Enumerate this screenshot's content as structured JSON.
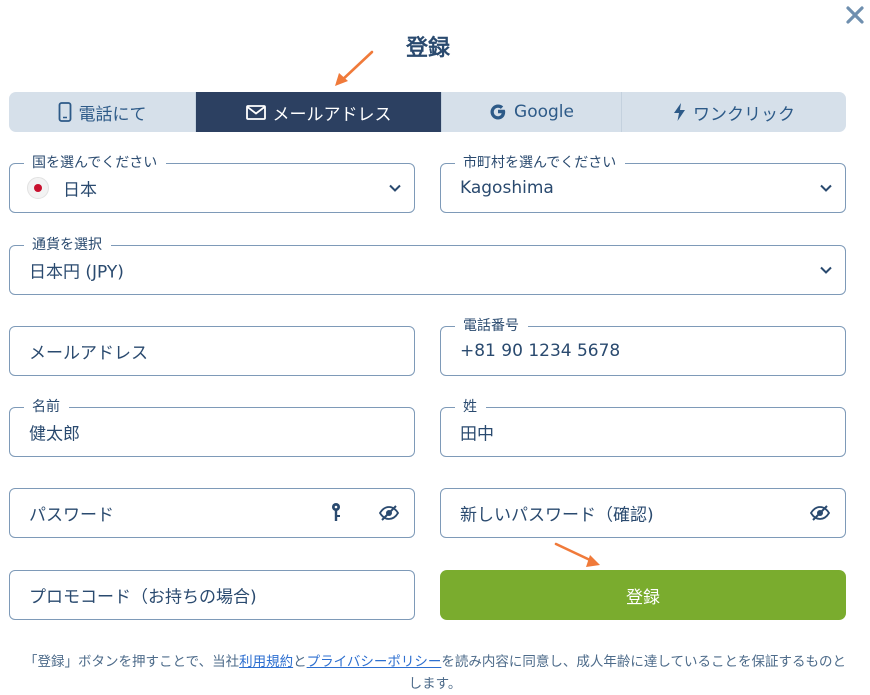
{
  "title": "登録",
  "close_icon": "close-icon",
  "tabs": [
    {
      "label": "電話にて",
      "icon": "phone-icon"
    },
    {
      "label": "メールアドレス",
      "icon": "envelope-icon",
      "active": true
    },
    {
      "label": "Google",
      "icon": "google-icon"
    },
    {
      "label": "ワンクリック",
      "icon": "lightning-icon"
    }
  ],
  "form": {
    "country": {
      "label": "国を選んでください",
      "value": "日本"
    },
    "city": {
      "label": "市町村を選んでください",
      "value": "Kagoshima"
    },
    "currency": {
      "label": "通貨を選択",
      "value": "日本円 (JPY)"
    },
    "email": {
      "placeholder": "メールアドレス"
    },
    "phone": {
      "label": "電話番号",
      "value": "+81 90 1234 5678"
    },
    "first_name": {
      "label": "名前",
      "value": "健太郎"
    },
    "last_name": {
      "label": "姓",
      "value": "田中"
    },
    "password": {
      "placeholder": "パスワード"
    },
    "password_confirm": {
      "placeholder": "新しいパスワード（確認)"
    },
    "promo": {
      "placeholder": "プロモコード（お持ちの場合)"
    }
  },
  "submit_label": "登録",
  "terms": {
    "prefix": "「登録」ボタンを押すことで、当社",
    "link1": "利用規約",
    "and": "と",
    "link2": "プライバシーポリシー",
    "suffix": "を読み内容に同意し、成人年齢に達していることを保証するものとします。"
  },
  "colors": {
    "primary_text": "#2a4a6f",
    "active_tab": "#2c4061",
    "tab_bg": "#d6e0ea",
    "submit_bg": "#7aac2e",
    "link": "#2d6fd0",
    "annotation_arrow": "#f07a3a"
  }
}
